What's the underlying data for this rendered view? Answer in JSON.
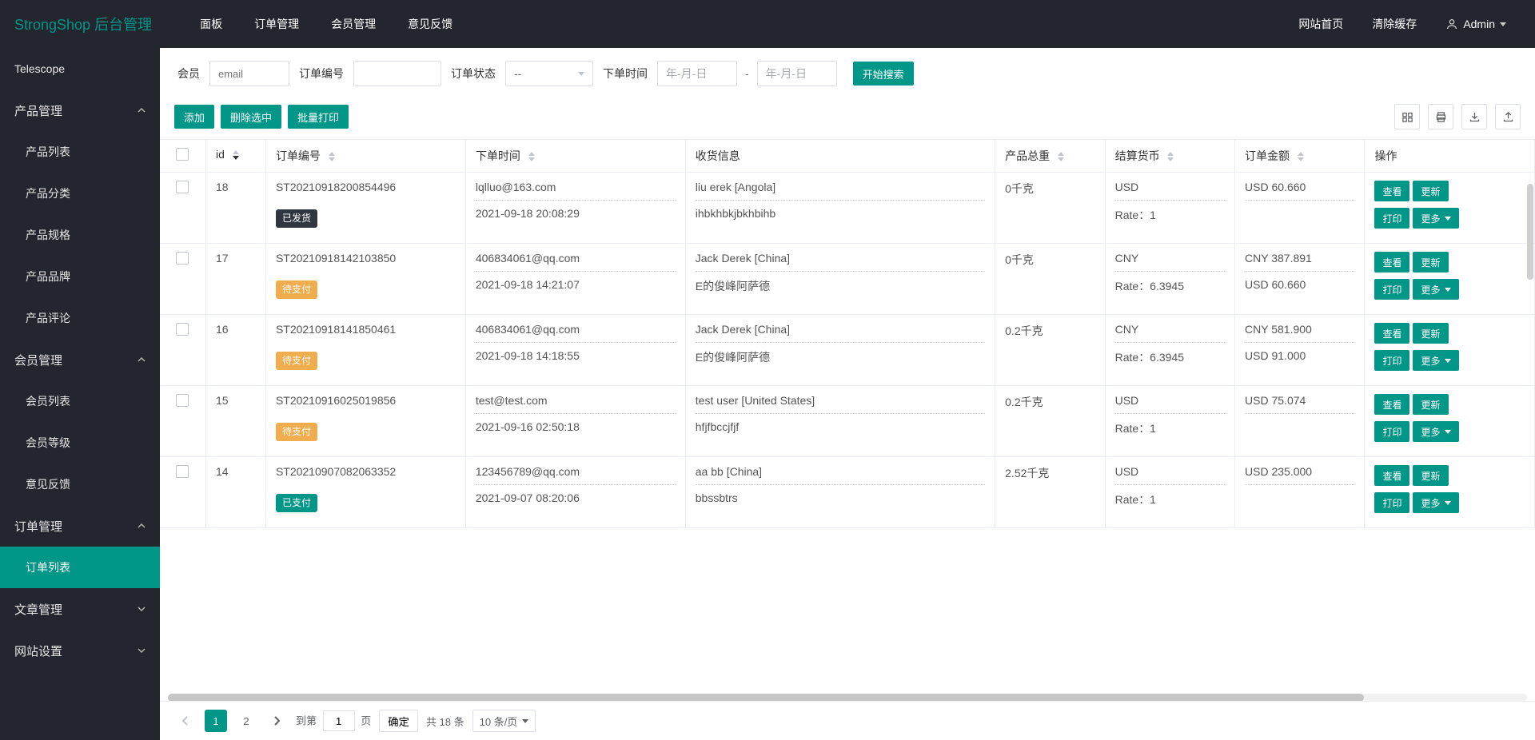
{
  "brand": "StrongShop 后台管理",
  "topnav": {
    "items": [
      {
        "label": "面板"
      },
      {
        "label": "订单管理"
      },
      {
        "label": "会员管理"
      },
      {
        "label": "意见反馈"
      }
    ]
  },
  "top_right": {
    "site_link": "网站首页",
    "clear_cache": "清除缓存",
    "user_name": "Admin"
  },
  "sidebar": {
    "telescope": "Telescope",
    "groups": [
      {
        "label": "产品管理",
        "open": true,
        "items": [
          {
            "label": "产品列表"
          },
          {
            "label": "产品分类"
          },
          {
            "label": "产品规格"
          },
          {
            "label": "产品品牌"
          },
          {
            "label": "产品评论"
          }
        ]
      },
      {
        "label": "会员管理",
        "open": true,
        "items": [
          {
            "label": "会员列表"
          },
          {
            "label": "会员等级"
          },
          {
            "label": "意见反馈"
          }
        ]
      },
      {
        "label": "订单管理",
        "open": true,
        "items": [
          {
            "label": "订单列表",
            "active": true
          }
        ]
      },
      {
        "label": "文章管理",
        "open": false,
        "items": []
      },
      {
        "label": "网站设置",
        "open": false,
        "items": []
      }
    ]
  },
  "filters": {
    "member_label": "会员",
    "member_placeholder": "email",
    "order_no_label": "订单编号",
    "order_status_label": "订单状态",
    "order_status_value": "--",
    "order_time_label": "下单时间",
    "date_placeholder": "年-月-日",
    "date_sep": "-",
    "search_btn": "开始搜索"
  },
  "toolbar": {
    "add_btn": "添加",
    "del_sel_btn": "删除选中",
    "batch_print_btn": "批量打印"
  },
  "table": {
    "headers": {
      "id": "id",
      "order_no": "订单编号",
      "order_time": "下单时间",
      "ship_info": "收货信息",
      "weight": "产品总重",
      "currency": "结算货币",
      "amount": "订单金额",
      "actions": "操作"
    },
    "action_labels": {
      "view": "查看",
      "update": "更新",
      "print": "打印",
      "more": "更多"
    },
    "rows": [
      {
        "id": "18",
        "order_no": "ST20210918200854496",
        "status_text": "已发货",
        "status_class": "badge-shipped",
        "email": "lqlluo@163.com",
        "time": "2021-09-18 20:08:29",
        "ship1": "liu erek [Angola]",
        "ship2": "ihbkhbkjbkhbihb",
        "weight": "0千克",
        "currency": "USD",
        "rate": "Rate：1",
        "amount1": "USD 60.660",
        "amount2": ""
      },
      {
        "id": "17",
        "order_no": "ST20210918142103850",
        "status_text": "待支付",
        "status_class": "badge-pending",
        "email": "406834061@qq.com",
        "time": "2021-09-18 14:21:07",
        "ship1": "Jack Derek [China]",
        "ship2": "E的俊峰阿萨德",
        "weight": "0千克",
        "currency": "CNY",
        "rate": "Rate：6.3945",
        "amount1": "CNY 387.891",
        "amount2": "USD 60.660"
      },
      {
        "id": "16",
        "order_no": "ST20210918141850461",
        "status_text": "待支付",
        "status_class": "badge-pending",
        "email": "406834061@qq.com",
        "time": "2021-09-18 14:18:55",
        "ship1": "Jack Derek [China]",
        "ship2": "E的俊峰阿萨德",
        "weight": "0.2千克",
        "currency": "CNY",
        "rate": "Rate：6.3945",
        "amount1": "CNY 581.900",
        "amount2": "USD 91.000"
      },
      {
        "id": "15",
        "order_no": "ST20210916025019856",
        "status_text": "待支付",
        "status_class": "badge-pending",
        "email": "test@test.com",
        "time": "2021-09-16 02:50:18",
        "ship1": "test user [United States]",
        "ship2": "hfjfbccjfjf",
        "weight": "0.2千克",
        "currency": "USD",
        "rate": "Rate：1",
        "amount1": "USD 75.074",
        "amount2": ""
      },
      {
        "id": "14",
        "order_no": "ST20210907082063352",
        "status_text": "已支付",
        "status_class": "badge-paid",
        "email": "123456789@qq.com",
        "time": "2021-09-07 08:20:06",
        "ship1": "aa bb [China]",
        "ship2": "bbssbtrs",
        "weight": "2.52千克",
        "currency": "USD",
        "rate": "Rate：1",
        "amount1": "USD 235.000",
        "amount2": ""
      }
    ]
  },
  "pagination": {
    "pages": [
      "1",
      "2"
    ],
    "goto_label": "到第",
    "goto_value": "1",
    "page_suffix": "页",
    "confirm": "确定",
    "total_text": "共 18 条",
    "page_size_text": "10 条/页"
  }
}
